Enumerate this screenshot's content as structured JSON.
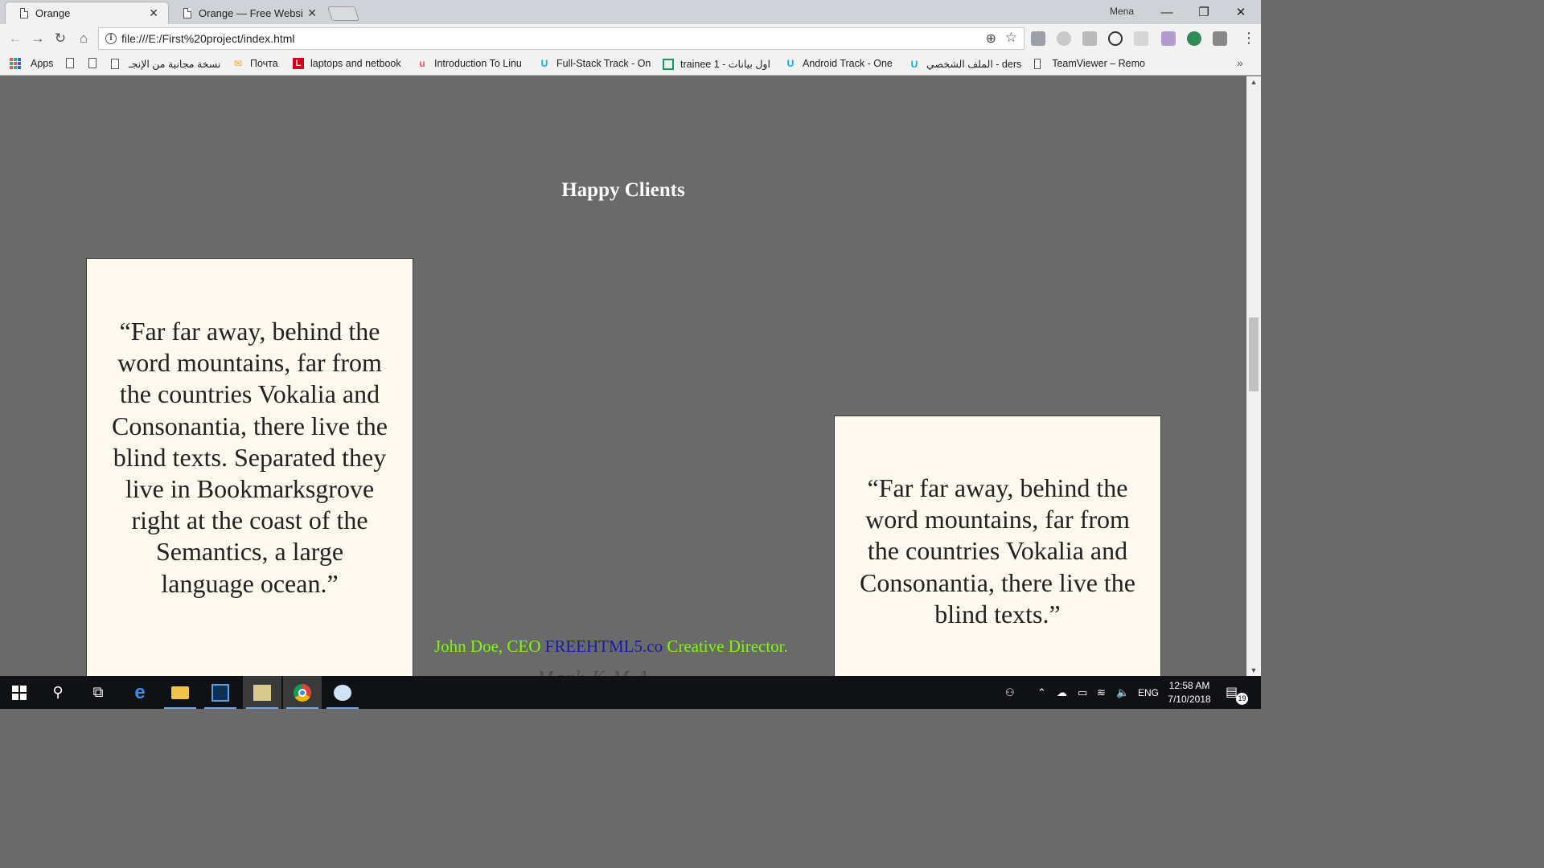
{
  "browser": {
    "tabs": [
      {
        "title": "Orange",
        "active": true
      },
      {
        "title": "Orange — Free Website T",
        "active": false
      }
    ],
    "profile_name": "Mena",
    "window_controls": {
      "minimize": "—",
      "restore": "❐",
      "close": "✕"
    },
    "url": "file:///E:/First%20project/index.html",
    "bookmarks": [
      {
        "label": "Apps",
        "icon": "apps-grid-icon"
      },
      {
        "label": "",
        "icon": "page-icon"
      },
      {
        "label": "",
        "icon": "page-icon"
      },
      {
        "label": "نسخة مجانية من الإنجـ",
        "icon": "page-icon"
      },
      {
        "label": "Почта",
        "icon": "mail-icon"
      },
      {
        "label": "laptops and netbook",
        "icon": "l-logo-icon"
      },
      {
        "label": "Introduction To Linu",
        "icon": "udemy-icon"
      },
      {
        "label": "Full-Stack Track - On",
        "icon": "udacity-icon"
      },
      {
        "label": "trainee 1 - اول بيانات",
        "icon": "sheets-icon"
      },
      {
        "label": "Android Track - One",
        "icon": "udacity-icon"
      },
      {
        "label": "الملف الشخصي - ders",
        "icon": "udacity-icon"
      },
      {
        "label": "TeamViewer – Remo",
        "icon": "page-icon"
      }
    ],
    "bookmarks_overflow": "»"
  },
  "page": {
    "section_title": "Happy Clients",
    "testimonial_left": "“Far far away, behind the word mountains, far from the countries Vokalia and Consonantia, there live the blind texts. Separated they live in Bookmarksgrove right at the coast of the Semantics, a large language ocean.”",
    "testimonial_right": "“Far far away, behind the word mountains, far from the countries Vokalia and Consonantia, there live the blind texts.”",
    "author": {
      "name": "John Doe, CEO",
      "company": "FREEHTML5.co",
      "role": "Creative Director."
    },
    "watermark": "Mark K.M.A"
  },
  "taskbar": {
    "language": "ENG",
    "time": "12:58 AM",
    "date": "7/10/2018",
    "notification_count": "19"
  },
  "colors": {
    "page_background": "#6a6a6a",
    "card_background": "#fdf9ef",
    "author_text": "#7cfc00",
    "author_link": "#1a1aa8"
  }
}
